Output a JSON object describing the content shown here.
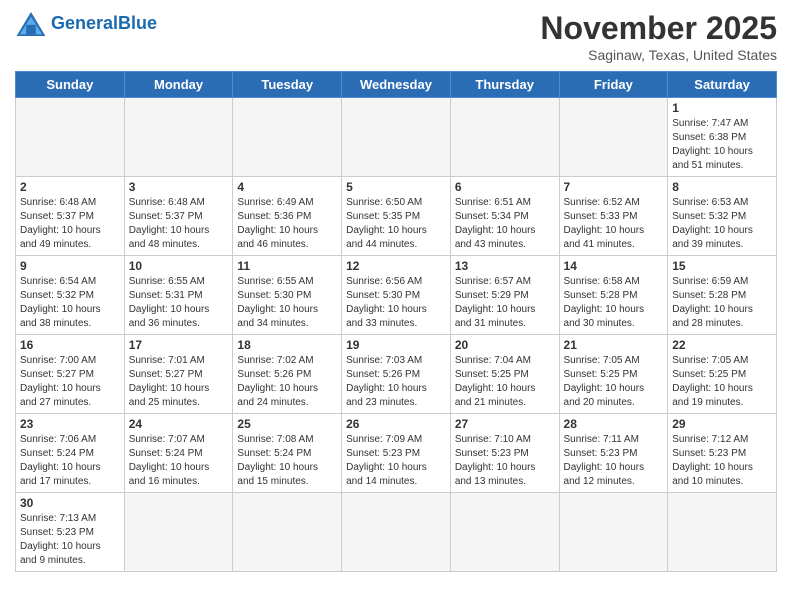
{
  "header": {
    "logo_general": "General",
    "logo_blue": "Blue",
    "month_title": "November 2025",
    "location": "Saginaw, Texas, United States"
  },
  "weekdays": [
    "Sunday",
    "Monday",
    "Tuesday",
    "Wednesday",
    "Thursday",
    "Friday",
    "Saturday"
  ],
  "weeks": [
    [
      {
        "day": "",
        "info": ""
      },
      {
        "day": "",
        "info": ""
      },
      {
        "day": "",
        "info": ""
      },
      {
        "day": "",
        "info": ""
      },
      {
        "day": "",
        "info": ""
      },
      {
        "day": "",
        "info": ""
      },
      {
        "day": "1",
        "info": "Sunrise: 7:47 AM\nSunset: 6:38 PM\nDaylight: 10 hours and 51 minutes."
      }
    ],
    [
      {
        "day": "2",
        "info": "Sunrise: 6:48 AM\nSunset: 5:37 PM\nDaylight: 10 hours and 49 minutes."
      },
      {
        "day": "3",
        "info": "Sunrise: 6:48 AM\nSunset: 5:37 PM\nDaylight: 10 hours and 48 minutes."
      },
      {
        "day": "4",
        "info": "Sunrise: 6:49 AM\nSunset: 5:36 PM\nDaylight: 10 hours and 46 minutes."
      },
      {
        "day": "5",
        "info": "Sunrise: 6:50 AM\nSunset: 5:35 PM\nDaylight: 10 hours and 44 minutes."
      },
      {
        "day": "6",
        "info": "Sunrise: 6:51 AM\nSunset: 5:34 PM\nDaylight: 10 hours and 43 minutes."
      },
      {
        "day": "7",
        "info": "Sunrise: 6:52 AM\nSunset: 5:33 PM\nDaylight: 10 hours and 41 minutes."
      },
      {
        "day": "8",
        "info": "Sunrise: 6:53 AM\nSunset: 5:32 PM\nDaylight: 10 hours and 39 minutes."
      }
    ],
    [
      {
        "day": "9",
        "info": "Sunrise: 6:54 AM\nSunset: 5:32 PM\nDaylight: 10 hours and 38 minutes."
      },
      {
        "day": "10",
        "info": "Sunrise: 6:55 AM\nSunset: 5:31 PM\nDaylight: 10 hours and 36 minutes."
      },
      {
        "day": "11",
        "info": "Sunrise: 6:55 AM\nSunset: 5:30 PM\nDaylight: 10 hours and 34 minutes."
      },
      {
        "day": "12",
        "info": "Sunrise: 6:56 AM\nSunset: 5:30 PM\nDaylight: 10 hours and 33 minutes."
      },
      {
        "day": "13",
        "info": "Sunrise: 6:57 AM\nSunset: 5:29 PM\nDaylight: 10 hours and 31 minutes."
      },
      {
        "day": "14",
        "info": "Sunrise: 6:58 AM\nSunset: 5:28 PM\nDaylight: 10 hours and 30 minutes."
      },
      {
        "day": "15",
        "info": "Sunrise: 6:59 AM\nSunset: 5:28 PM\nDaylight: 10 hours and 28 minutes."
      }
    ],
    [
      {
        "day": "16",
        "info": "Sunrise: 7:00 AM\nSunset: 5:27 PM\nDaylight: 10 hours and 27 minutes."
      },
      {
        "day": "17",
        "info": "Sunrise: 7:01 AM\nSunset: 5:27 PM\nDaylight: 10 hours and 25 minutes."
      },
      {
        "day": "18",
        "info": "Sunrise: 7:02 AM\nSunset: 5:26 PM\nDaylight: 10 hours and 24 minutes."
      },
      {
        "day": "19",
        "info": "Sunrise: 7:03 AM\nSunset: 5:26 PM\nDaylight: 10 hours and 23 minutes."
      },
      {
        "day": "20",
        "info": "Sunrise: 7:04 AM\nSunset: 5:25 PM\nDaylight: 10 hours and 21 minutes."
      },
      {
        "day": "21",
        "info": "Sunrise: 7:05 AM\nSunset: 5:25 PM\nDaylight: 10 hours and 20 minutes."
      },
      {
        "day": "22",
        "info": "Sunrise: 7:05 AM\nSunset: 5:25 PM\nDaylight: 10 hours and 19 minutes."
      }
    ],
    [
      {
        "day": "23",
        "info": "Sunrise: 7:06 AM\nSunset: 5:24 PM\nDaylight: 10 hours and 17 minutes."
      },
      {
        "day": "24",
        "info": "Sunrise: 7:07 AM\nSunset: 5:24 PM\nDaylight: 10 hours and 16 minutes."
      },
      {
        "day": "25",
        "info": "Sunrise: 7:08 AM\nSunset: 5:24 PM\nDaylight: 10 hours and 15 minutes."
      },
      {
        "day": "26",
        "info": "Sunrise: 7:09 AM\nSunset: 5:23 PM\nDaylight: 10 hours and 14 minutes."
      },
      {
        "day": "27",
        "info": "Sunrise: 7:10 AM\nSunset: 5:23 PM\nDaylight: 10 hours and 13 minutes."
      },
      {
        "day": "28",
        "info": "Sunrise: 7:11 AM\nSunset: 5:23 PM\nDaylight: 10 hours and 12 minutes."
      },
      {
        "day": "29",
        "info": "Sunrise: 7:12 AM\nSunset: 5:23 PM\nDaylight: 10 hours and 10 minutes."
      }
    ],
    [
      {
        "day": "30",
        "info": "Sunrise: 7:13 AM\nSunset: 5:23 PM\nDaylight: 10 hours and 9 minutes."
      },
      {
        "day": "",
        "info": ""
      },
      {
        "day": "",
        "info": ""
      },
      {
        "day": "",
        "info": ""
      },
      {
        "day": "",
        "info": ""
      },
      {
        "day": "",
        "info": ""
      },
      {
        "day": "",
        "info": ""
      }
    ]
  ]
}
